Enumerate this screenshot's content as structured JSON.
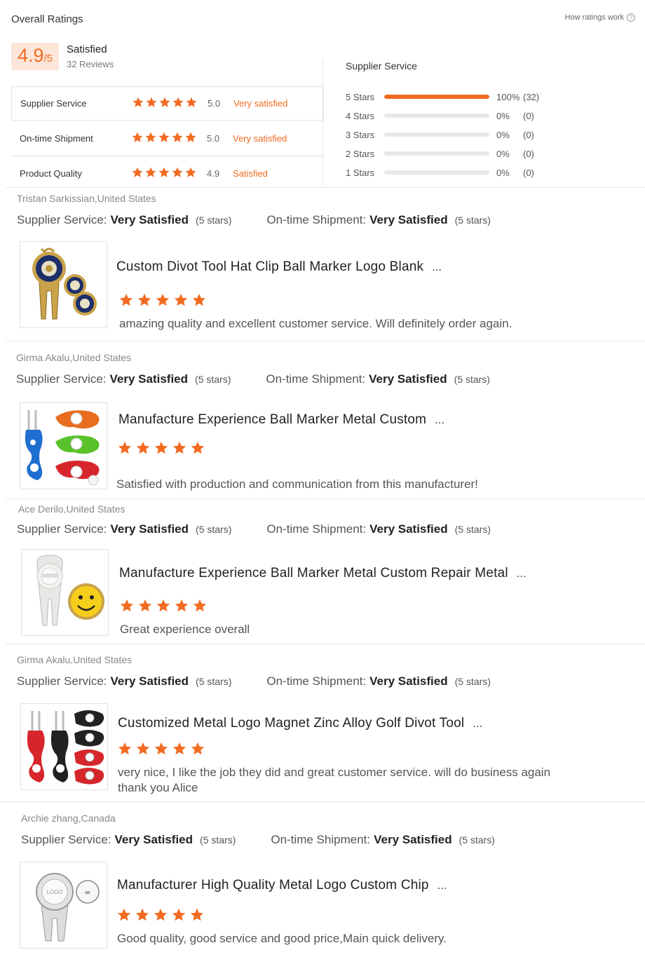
{
  "header": {
    "title": "Overall Ratings",
    "how_link": "How ratings work",
    "help_glyph": "?",
    "score": "4.9",
    "score_suffix": "/5",
    "satisfaction": "Satisfied",
    "reviews": "32 Reviews"
  },
  "categories": [
    {
      "name": "Supplier Service",
      "value": "5.0",
      "label": "Very satisfied"
    },
    {
      "name": "On-time Shipment",
      "value": "5.0",
      "label": "Very satisfied"
    },
    {
      "name": "Product Quality",
      "value": "4.9",
      "label": "Satisfied"
    }
  ],
  "distribution": {
    "title": "Supplier Service",
    "rows": [
      {
        "label": "5 Stars",
        "fraction": 1.0,
        "pct": "100%",
        "count": "(32)"
      },
      {
        "label": "4 Stars",
        "fraction": 0,
        "pct": "0%",
        "count": "(0)"
      },
      {
        "label": "3 Stars",
        "fraction": 0,
        "pct": "0%",
        "count": "(0)"
      },
      {
        "label": "2 Stars",
        "fraction": 0,
        "pct": "0%",
        "count": "(0)"
      },
      {
        "label": "1 Stars",
        "fraction": 0,
        "pct": "0%",
        "count": "(0)"
      }
    ]
  },
  "labels": {
    "supplier_service": "Supplier Service:",
    "ontime_shipment": "On-time Shipment:",
    "very_satisfied": "Very Satisfied",
    "five_stars": "(5 stars)",
    "ellipsis": "..."
  },
  "reviews": [
    {
      "author": "Tristan Sarkissian,United States",
      "product": "Custom Divot Tool Hat Clip Ball Marker Logo Blank",
      "text": "amazing quality and excellent customer service. Will definitely order again."
    },
    {
      "author": "Girma Akalu,United States",
      "product": "Manufacture Experience Ball Marker Metal Custom",
      "text": "Satisfied with production and communication from this manufacturer!"
    },
    {
      "author": "Ace Derilo,United States",
      "product": "Manufacture Experience Ball Marker Metal Custom Repair Metal",
      "text": "Great experience overall"
    },
    {
      "author": "Girma Akalu,United States",
      "product": "Customized Metal Logo Magnet Zinc Alloy Golf Divot Tool",
      "text": "very nice, I like the job they did and great customer service. will do business again thank you Alice"
    },
    {
      "author": "Archie zhang,Canada",
      "product": "Manufacturer High Quality Metal Logo Custom Chip",
      "text": "Good quality, good service and good price,Main quick delivery."
    }
  ],
  "image_text": {
    "logo": "LOGO"
  },
  "colors": {
    "accent": "#f26b21",
    "score_bg": "#fde5da"
  }
}
